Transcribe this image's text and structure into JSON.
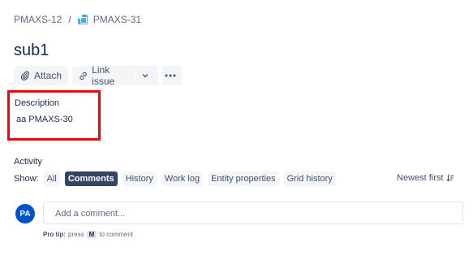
{
  "breadcrumb": {
    "parent": "PMAXS-12",
    "separator": "/",
    "current": "PMAXS-31"
  },
  "issue": {
    "title": "sub1"
  },
  "toolbar": {
    "attach_label": "Attach",
    "link_issue_label": "Link issue",
    "more_icon": "more-icon",
    "dropdown_icon": "chevron-down-icon"
  },
  "description": {
    "label": "Description",
    "value": "aa PMAXS-30"
  },
  "activity": {
    "title": "Activity",
    "show_label": "Show:",
    "filters": [
      "All",
      "Comments",
      "History",
      "Work log",
      "Entity properties",
      "Grid history"
    ],
    "active_filter": "Comments",
    "sort_label": "Newest first",
    "sort_icon": "sort-icon"
  },
  "comment": {
    "avatar_initials": "PA",
    "placeholder": "Add a comment...",
    "protip_bold": "Pro tip:",
    "protip_pre": "press",
    "protip_key": "M",
    "protip_post": "to comment"
  },
  "colors": {
    "highlight": "#ff0000",
    "avatar": "#0052cc",
    "active_chip": "#344563",
    "subtask_icon": "#4bade8"
  }
}
